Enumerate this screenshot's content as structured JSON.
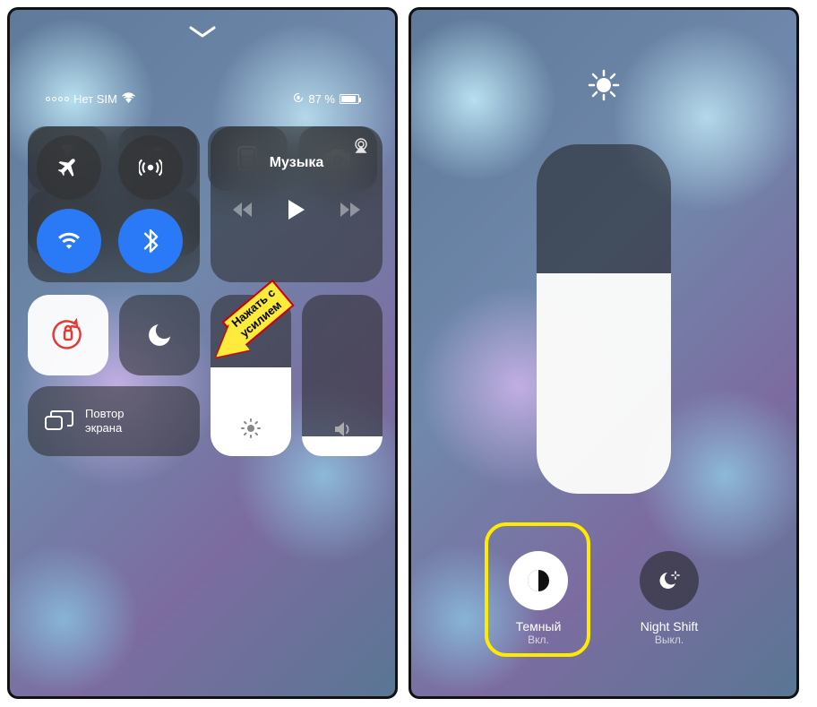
{
  "status": {
    "carrier": "Нет SIM",
    "battery_pct": "87 %"
  },
  "music": {
    "title": "Музыка"
  },
  "screen_mirror": {
    "line1": "Повтор",
    "line2": "экрана"
  },
  "brightness": {
    "main_pct": 55,
    "annotation_l1": "Нажать с",
    "annotation_l2": "усилием"
  },
  "expanded": {
    "fill_pct": 63,
    "dark": {
      "label": "Темный",
      "state": "Вкл."
    },
    "night": {
      "label": "Night Shift",
      "state": "Выкл."
    }
  }
}
